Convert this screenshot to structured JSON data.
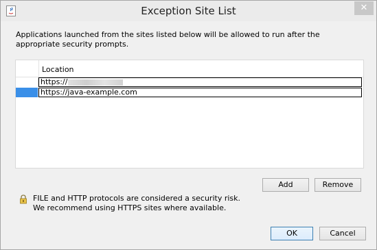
{
  "window": {
    "title": "Exception Site List",
    "close_glyph": "✕"
  },
  "description": "Applications launched from the sites listed below will be allowed to run after the appropriate security prompts.",
  "table": {
    "column_header": "Location",
    "rows": [
      {
        "location": "https://",
        "selected": false
      },
      {
        "location": "https://java-example.com",
        "selected": true
      }
    ]
  },
  "buttons": {
    "add": "Add",
    "remove": "Remove",
    "ok": "OK",
    "cancel": "Cancel"
  },
  "warning": {
    "line1": "FILE and HTTP protocols are considered a security risk.",
    "line2": "We recommend using HTTPS sites where available."
  },
  "icons": {
    "app": "java-icon",
    "warning": "padlock-warning-icon"
  },
  "colors": {
    "selection": "#3a8fe8",
    "ok_border": "#3c7fb1"
  }
}
